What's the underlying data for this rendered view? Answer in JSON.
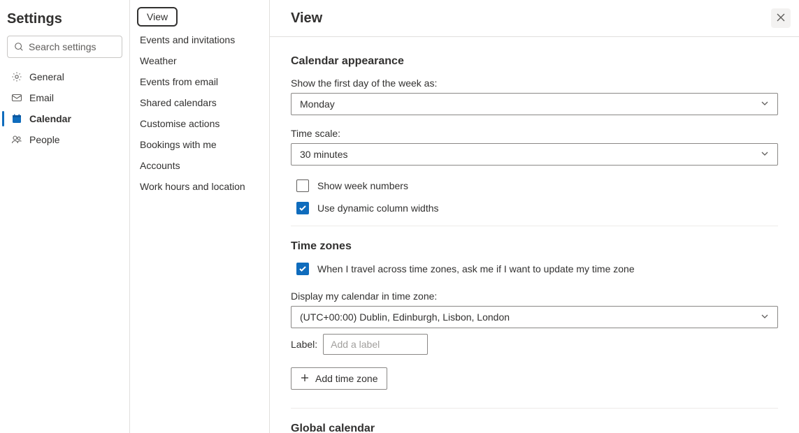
{
  "header": {
    "title": "Settings"
  },
  "search": {
    "placeholder": "Search settings"
  },
  "nav": {
    "items": [
      {
        "label": "General"
      },
      {
        "label": "Email"
      },
      {
        "label": "Calendar"
      },
      {
        "label": "People"
      }
    ]
  },
  "subnav": {
    "items": [
      {
        "label": "View"
      },
      {
        "label": "Events and invitations"
      },
      {
        "label": "Weather"
      },
      {
        "label": "Events from email"
      },
      {
        "label": "Shared calendars"
      },
      {
        "label": "Customise actions"
      },
      {
        "label": "Bookings with me"
      },
      {
        "label": "Accounts"
      },
      {
        "label": "Work hours and location"
      }
    ]
  },
  "main": {
    "title": "View",
    "appearance": {
      "heading": "Calendar appearance",
      "firstDayLabel": "Show the first day of the week as:",
      "firstDayValue": "Monday",
      "timeScaleLabel": "Time scale:",
      "timeScaleValue": "30 minutes",
      "weekNumbersLabel": "Show week numbers",
      "dynamicWidthsLabel": "Use dynamic column widths"
    },
    "tz": {
      "heading": "Time zones",
      "travelLabel": "When I travel across time zones, ask me if I want to update my time zone",
      "displayLabel": "Display my calendar in time zone:",
      "displayValue": "(UTC+00:00) Dublin, Edinburgh, Lisbon, London",
      "labelText": "Label:",
      "labelPlaceholder": "Add a label",
      "addButton": "Add time zone"
    },
    "global": {
      "heading": "Global calendar"
    }
  }
}
